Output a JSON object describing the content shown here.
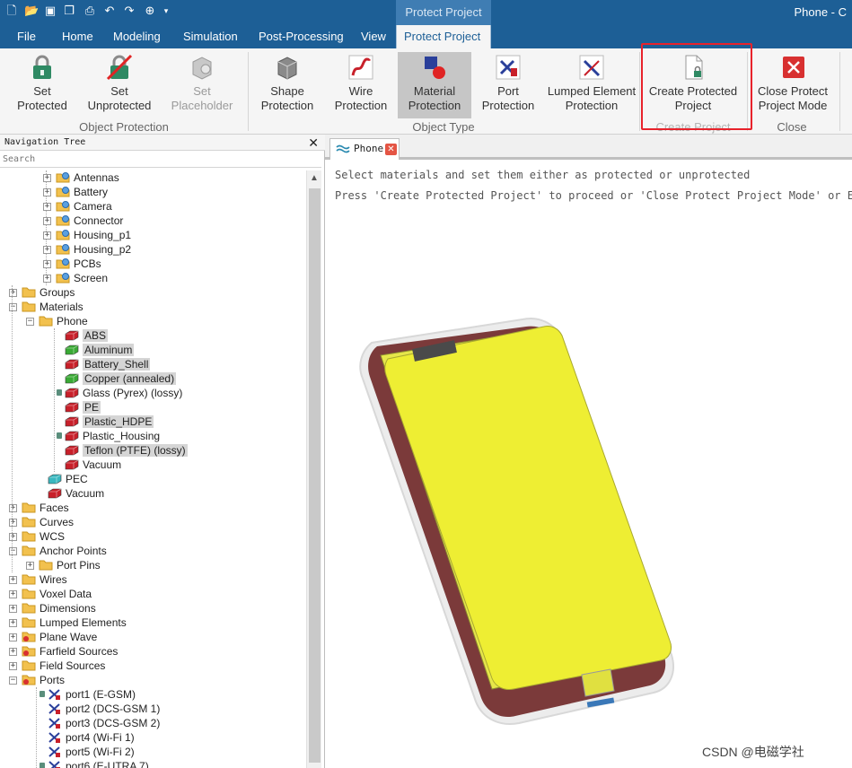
{
  "window": {
    "title": "Phone - C",
    "context_tab_header": "Protect Project"
  },
  "quick_access": [
    "new-icon",
    "open-icon",
    "save-icon",
    "save-all-icon",
    "print-icon",
    "undo-icon",
    "redo-icon",
    "globe-icon",
    "customize-icon"
  ],
  "menu": {
    "file": "File",
    "home": "Home",
    "modeling": "Modeling",
    "simulation": "Simulation",
    "post_processing": "Post-Processing",
    "view": "View",
    "protect_project": "Protect Project"
  },
  "ribbon": {
    "object_protection": {
      "label": "Object Protection",
      "set_protected": "Set\nProtected",
      "set_unprotected": "Set\nUnprotected",
      "set_placeholder": "Set\nPlaceholder"
    },
    "object_type": {
      "label": "Object Type",
      "shape_protection": "Shape\nProtection",
      "wire_protection": "Wire\nProtection",
      "material_protection": "Material\nProtection",
      "port_protection": "Port\nProtection",
      "lumped_element_protection": "Lumped Element\nProtection"
    },
    "create_project": {
      "label": "Create Project",
      "create_protected_project": "Create Protected\nProject"
    },
    "close": {
      "label": "Close",
      "close_protect_project_mode": "Close Protect\nProject Mode"
    }
  },
  "nav": {
    "title": "Navigation Tree",
    "search_placeholder": "Search",
    "components": [
      "Antennas",
      "Battery",
      "Camera",
      "Connector",
      "Housing_p1",
      "Housing_p2",
      "PCBs",
      "Screen"
    ],
    "groups": "Groups",
    "materials": "Materials",
    "phone": "Phone",
    "phone_materials": [
      {
        "label": "ABS",
        "selected": true,
        "color": "#c8202a",
        "locked": false
      },
      {
        "label": "Aluminum",
        "selected": true,
        "color": "#3aaa35",
        "locked": false
      },
      {
        "label": "Battery_Shell",
        "selected": true,
        "color": "#c8202a",
        "locked": false
      },
      {
        "label": "Copper (annealed)",
        "selected": true,
        "color": "#3aaa35",
        "locked": false
      },
      {
        "label": "Glass (Pyrex) (lossy)",
        "selected": false,
        "color": "#c8202a",
        "locked": true
      },
      {
        "label": "PE",
        "selected": true,
        "color": "#c8202a",
        "locked": false
      },
      {
        "label": "Plastic_HDPE",
        "selected": true,
        "color": "#c8202a",
        "locked": false
      },
      {
        "label": "Plastic_Housing",
        "selected": false,
        "color": "#c8202a",
        "locked": true
      },
      {
        "label": "Teflon (PTFE) (lossy)",
        "selected": true,
        "color": "#c8202a",
        "locked": false
      },
      {
        "label": "Vacuum",
        "selected": false,
        "color": "#c8202a",
        "locked": false
      }
    ],
    "pec": "PEC",
    "vacuum": "Vacuum",
    "faces": "Faces",
    "curves": "Curves",
    "wcs": "WCS",
    "anchor_points": "Anchor Points",
    "port_pins": "Port Pins",
    "wires": "Wires",
    "voxel_data": "Voxel Data",
    "dimensions": "Dimensions",
    "lumped_elements": "Lumped Elements",
    "plane_wave": "Plane Wave",
    "farfield_sources": "Farfield Sources",
    "field_sources": "Field Sources",
    "ports": "Ports",
    "port_list": [
      "port1 (E-GSM)",
      "port2 (DCS-GSM 1)",
      "port3 (DCS-GSM 2)",
      "port4 (Wi-Fi 1)",
      "port5 (Wi-Fi 2)",
      "port6 (E-UTRA 7)"
    ]
  },
  "doc": {
    "tab_label": "Phone",
    "instruction_1": "Select materials and set them either as protected or unprotected",
    "instruction_2": "Press 'Create Protected Project' to proceed or 'Close Protect Project Mode' or ESC to"
  },
  "watermark": "CSDN @电磁学社",
  "colors": {
    "title_bar": "#1d5f96",
    "phone_screen": "#eeee33",
    "phone_body": "#7b3a3a",
    "highlight": "#e8222b"
  }
}
